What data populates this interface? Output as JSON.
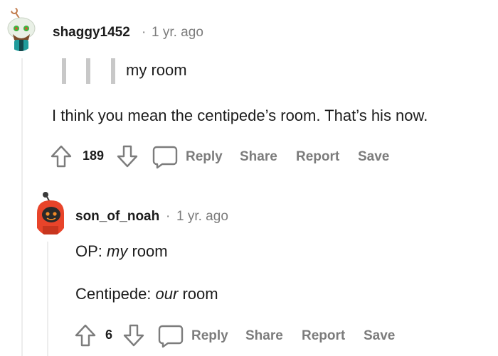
{
  "comment1": {
    "username": "shaggy1452",
    "separator": "·",
    "time": "1 yr. ago",
    "quote": "my room",
    "body": "I think you mean the centipede’s room. That’s his now.",
    "score": "189",
    "actions": {
      "reply": "Reply",
      "share": "Share",
      "report": "Report",
      "save": "Save"
    }
  },
  "comment2": {
    "username": "son_of_noah",
    "separator": "·",
    "time": "1 yr. ago",
    "line1_prefix": "OP: ",
    "line1_em": "my",
    "line1_suffix": " room",
    "line2_prefix": "Centipede: ",
    "line2_em": "our",
    "line2_suffix": " room",
    "score": "6",
    "actions": {
      "reply": "Reply",
      "share": "Share",
      "report": "Report",
      "save": "Save"
    }
  },
  "colors": {
    "text": "#1c1c1c",
    "meta": "#7c7c7c",
    "thread_line": "#ededed",
    "avatar2_bg": "#e8442a"
  }
}
